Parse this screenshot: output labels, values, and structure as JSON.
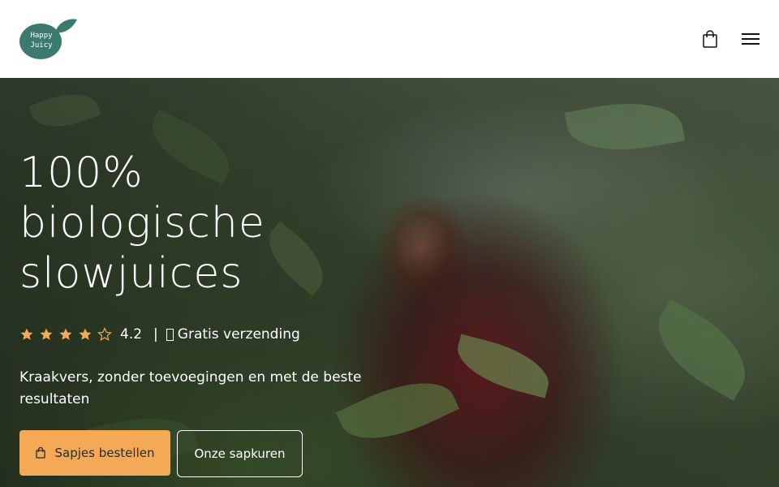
{
  "header": {
    "logo_text_line1": "Happy",
    "logo_text_line2": "Juicy",
    "logo_color": "#3d7a6e",
    "cart_icon": "shopping-bag-icon",
    "menu_icon": "hamburger-menu-icon"
  },
  "hero": {
    "title_lines": [
      "100%",
      "biologische",
      "slowjuices"
    ],
    "rating": {
      "stars_filled": 4,
      "stars_total": 5,
      "value": "4.2",
      "separator": "|",
      "shipping_text": "Gratis verzending",
      "star_color": "#f4a957"
    },
    "subtitle": "Kraakvers, zonder toevoegingen en met de beste resultaten",
    "primary_button": {
      "label": "Sapjes bestellen",
      "icon": "shopping-bag-icon",
      "color": "#f4a957"
    },
    "secondary_button": {
      "label": "Onze sapkuren"
    }
  }
}
